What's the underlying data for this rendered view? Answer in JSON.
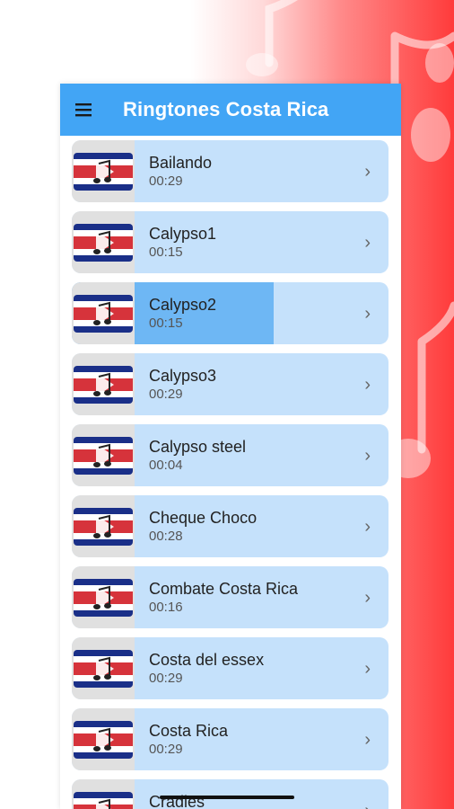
{
  "app": {
    "title": "Ringtones Costa Rica",
    "menu_icon": "hamburger-menu-icon"
  },
  "colors": {
    "appbar": "#42a5f5",
    "item_bg": "#c5e1fb",
    "item_active": "#6eb7f4",
    "flag_blue": "#1a2f88",
    "flag_red": "#d6333b"
  },
  "ringtones": [
    {
      "title": "Bailando",
      "duration": "00:29"
    },
    {
      "title": "Calypso1",
      "duration": "00:15"
    },
    {
      "title": "Calypso2",
      "duration": "00:15",
      "playing": true
    },
    {
      "title": "Calypso3",
      "duration": "00:29"
    },
    {
      "title": "Calypso steel",
      "duration": "00:04"
    },
    {
      "title": "Cheque Choco",
      "duration": "00:28"
    },
    {
      "title": "Combate Costa Rica",
      "duration": "00:16"
    },
    {
      "title": "Costa del essex",
      "duration": "00:29"
    },
    {
      "title": "Costa Rica",
      "duration": "00:29"
    },
    {
      "title": "Cradles",
      "duration": ""
    }
  ],
  "chevron_icon": "chevron-right-icon"
}
